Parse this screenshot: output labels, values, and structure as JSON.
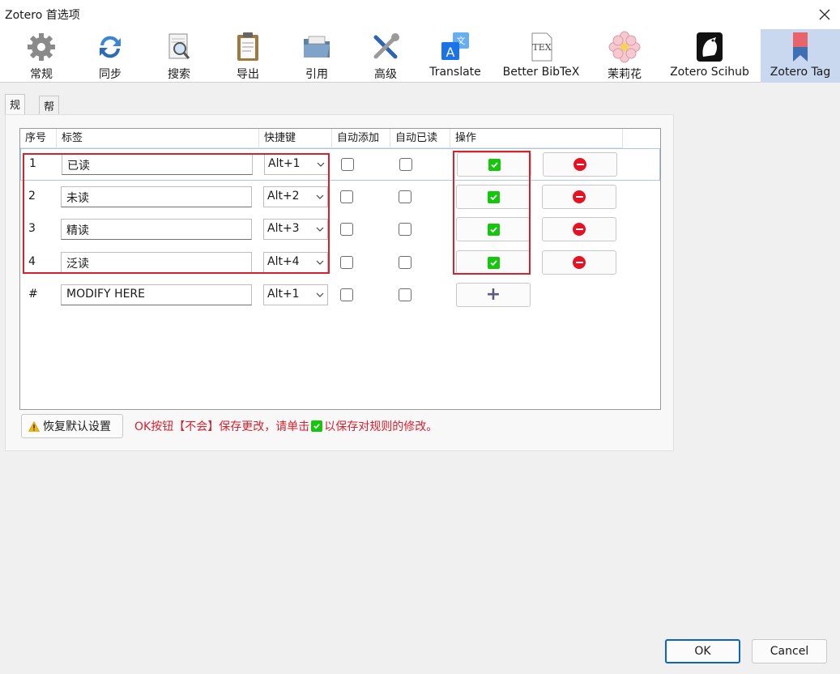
{
  "window": {
    "title": "Zotero 首选项"
  },
  "toolbar": {
    "items": [
      {
        "label": "常规",
        "icon": "gear-icon"
      },
      {
        "label": "同步",
        "icon": "sync-icon"
      },
      {
        "label": "搜索",
        "icon": "search-icon"
      },
      {
        "label": "导出",
        "icon": "clipboard-icon"
      },
      {
        "label": "引用",
        "icon": "folder-icon"
      },
      {
        "label": "高级",
        "icon": "tools-icon"
      },
      {
        "label": "Translate",
        "icon": "translate-icon"
      },
      {
        "label": "Better BibTeX",
        "icon": "tex-icon"
      },
      {
        "label": "茉莉花",
        "icon": "flower-icon"
      },
      {
        "label": "Zotero Scihub",
        "icon": "raven-icon"
      },
      {
        "label": "Zotero Tag",
        "icon": "bookmark-icon"
      }
    ],
    "selected": "Zotero Tag"
  },
  "subtabs": [
    {
      "label": "规则"
    },
    {
      "label": "帮助"
    }
  ],
  "table": {
    "headers": [
      "序号",
      "标签",
      "快捷键",
      "自动添加",
      "自动已读",
      "操作"
    ],
    "rows": [
      {
        "num": "1",
        "tag": "已读",
        "shortcut": "Alt+1",
        "auto_add": false,
        "auto_read": false
      },
      {
        "num": "2",
        "tag": "未读",
        "shortcut": "Alt+2",
        "auto_add": false,
        "auto_read": false
      },
      {
        "num": "3",
        "tag": "精读",
        "shortcut": "Alt+3",
        "auto_add": false,
        "auto_read": false
      },
      {
        "num": "4",
        "tag": "泛读",
        "shortcut": "Alt+4",
        "auto_add": false,
        "auto_read": false
      }
    ],
    "new_row": {
      "num": "#",
      "tag": "MODIFY HERE",
      "shortcut": "Alt+1",
      "auto_add": false,
      "auto_read": false
    }
  },
  "restore_label": "恢复默认设置",
  "notice": {
    "before": "OK按钮【不会】保存更改，请单击",
    "after": "以保存对规则的修改。"
  },
  "footer": {
    "ok_label": "OK",
    "cancel_label": "Cancel"
  },
  "colors": {
    "accent": "#0a64c4",
    "annotation_red": "#d7212f",
    "save_green": "#16c60c",
    "delete_red": "#e81123",
    "selected_tab": "#c9d7ef"
  }
}
